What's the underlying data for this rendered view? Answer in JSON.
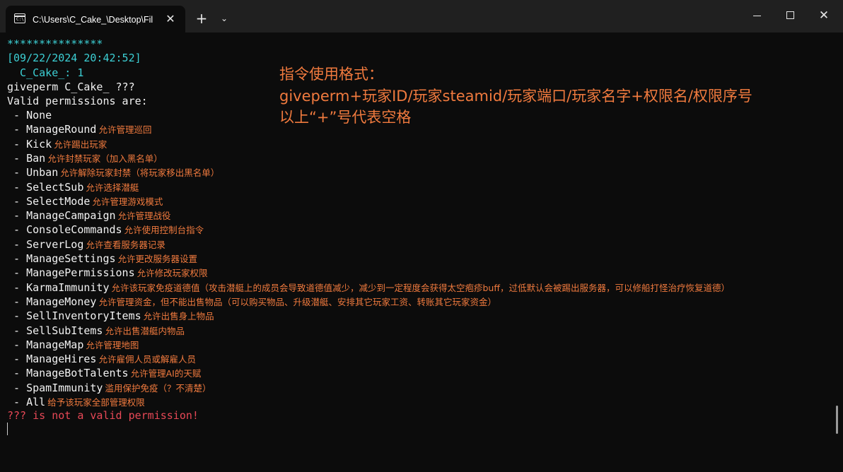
{
  "window": {
    "tab_title": "C:\\Users\\C_Cake_\\Desktop\\Fil",
    "tab_close_glyph": "✕",
    "new_tab_glyph": "+",
    "dropdown_glyph": "⌄",
    "close_glyph": "✕"
  },
  "terminal": {
    "stars": "***************",
    "timestamp": "[09/22/2024 20:42:52]",
    "user_line": "  C_Cake_: 1",
    "command": "giveperm C_Cake_ ???",
    "header": "Valid permissions are:",
    "permissions": [
      {
        "name": " - None",
        "note": ""
      },
      {
        "name": " - ManageRound",
        "note": "允许管理巡回"
      },
      {
        "name": " - Kick",
        "note": "允许踢出玩家"
      },
      {
        "name": " - Ban",
        "note": "允许封禁玩家（加入黑名单）"
      },
      {
        "name": " - Unban",
        "note": "允许解除玩家封禁（将玩家移出黑名单）"
      },
      {
        "name": " - SelectSub",
        "note": "允许选择潜艇"
      },
      {
        "name": " - SelectMode",
        "note": "允许管理游戏模式"
      },
      {
        "name": " - ManageCampaign",
        "note": "允许管理战役"
      },
      {
        "name": " - ConsoleCommands",
        "note": "允许使用控制台指令"
      },
      {
        "name": " - ServerLog",
        "note": "允许查看服务器记录"
      },
      {
        "name": " - ManageSettings",
        "note": "允许更改服务器设置"
      },
      {
        "name": " - ManagePermissions",
        "note": "允许修改玩家权限"
      },
      {
        "name": " - KarmaImmunity",
        "note": "允许该玩家免疫道德值（攻击潜艇上的成员会导致道德值减少，减少到一定程度会获得太空疱疹buff，过低默认会被踢出服务器，可以修船打怪治疗恢复道德）"
      },
      {
        "name": " - ManageMoney",
        "note": "允许管理资金，但不能出售物品（可以购买物品、升级潜艇、安排其它玩家工资、转账其它玩家资金）"
      },
      {
        "name": " - SellInventoryItems",
        "note": "允许出售身上物品"
      },
      {
        "name": " - SellSubItems",
        "note": "允许出售潜艇内物品"
      },
      {
        "name": " - ManageMap",
        "note": "允许管理地图"
      },
      {
        "name": " - ManageHires",
        "note": "允许雇佣人员或解雇人员"
      },
      {
        "name": " - ManageBotTalents",
        "note": "允许管理AI的天赋"
      },
      {
        "name": " - SpamImmunity",
        "note": "滥用保护免疫（？不清楚）"
      },
      {
        "name": " - All",
        "note": "给予该玩家全部管理权限"
      }
    ],
    "error": "??? is not a valid permission!"
  },
  "overlay": {
    "line1": "指令使用格式：",
    "line2": "giveperm+玩家ID/玩家steamid/玩家端口/玩家名字+权限名/权限序号",
    "line3": "以上“+”号代表空格"
  },
  "colors": {
    "cyan": "#3ccfd4",
    "annotation": "#f07a3e",
    "error": "#e74856",
    "background": "#0c0c0c",
    "titlebar": "#202020"
  },
  "icons": [
    "terminal-icon",
    "close-icon",
    "plus-icon",
    "chevron-down-icon",
    "minimize-icon",
    "maximize-icon",
    "window-close-icon"
  ]
}
